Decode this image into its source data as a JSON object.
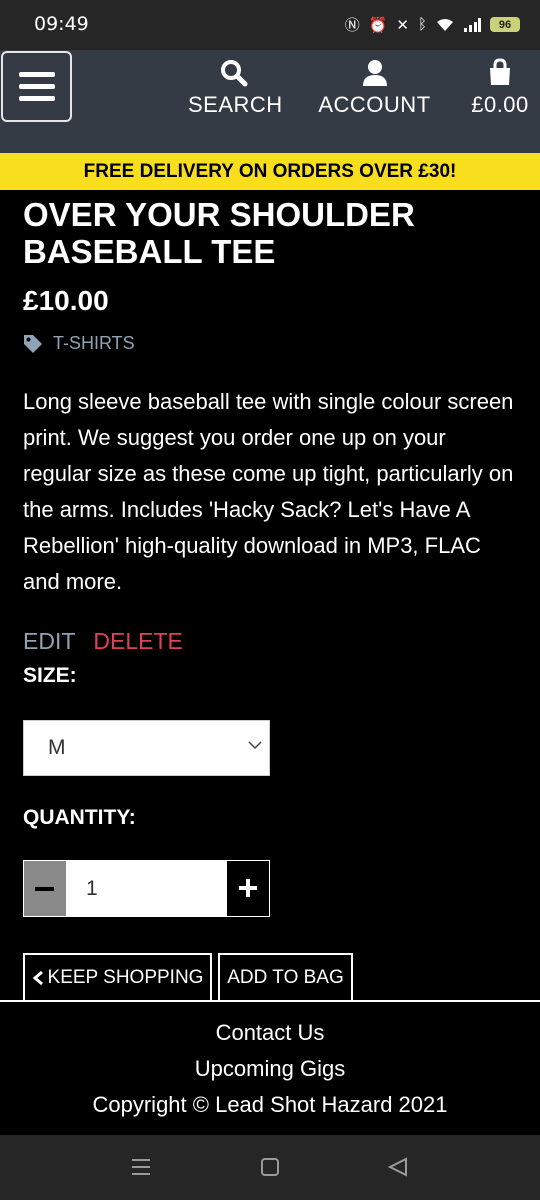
{
  "status_bar": {
    "time": "09:49",
    "battery": "96"
  },
  "nav": {
    "search_label": "SEARCH",
    "account_label": "ACCOUNT",
    "bag_total": "£0.00"
  },
  "banner": {
    "text": "FREE DELIVERY ON ORDERS OVER £30!"
  },
  "product": {
    "title_line1": "OVER YOUR SHOULDER",
    "title_line2": "BASEBALL TEE",
    "price": "£10.00",
    "category": "T-SHIRTS",
    "description": "Long sleeve baseball tee with single colour screen print. We suggest you order one up on your regular size as these come up tight, particularly on the arms. Includes 'Hacky Sack? Let's Have A Rebellion' high-quality download in MP3, FLAC and more."
  },
  "admin": {
    "edit_label": "EDIT",
    "delete_label": "DELETE"
  },
  "form": {
    "size_label": "SIZE:",
    "size_value": "M",
    "quantity_label": "QUANTITY:",
    "quantity_value": "1"
  },
  "buttons": {
    "keep_shopping": "KEEP SHOPPING",
    "add_to_bag": "ADD TO BAG"
  },
  "footer": {
    "contact": "Contact Us",
    "gigs": "Upcoming Gigs",
    "copyright": "Copyright © Lead Shot Hazard 2021"
  },
  "colors": {
    "navbar_bg": "#353b45",
    "banner_bg": "#f7df1e",
    "link_blue": "#8fa3b5",
    "delete_red": "#e0405a"
  }
}
